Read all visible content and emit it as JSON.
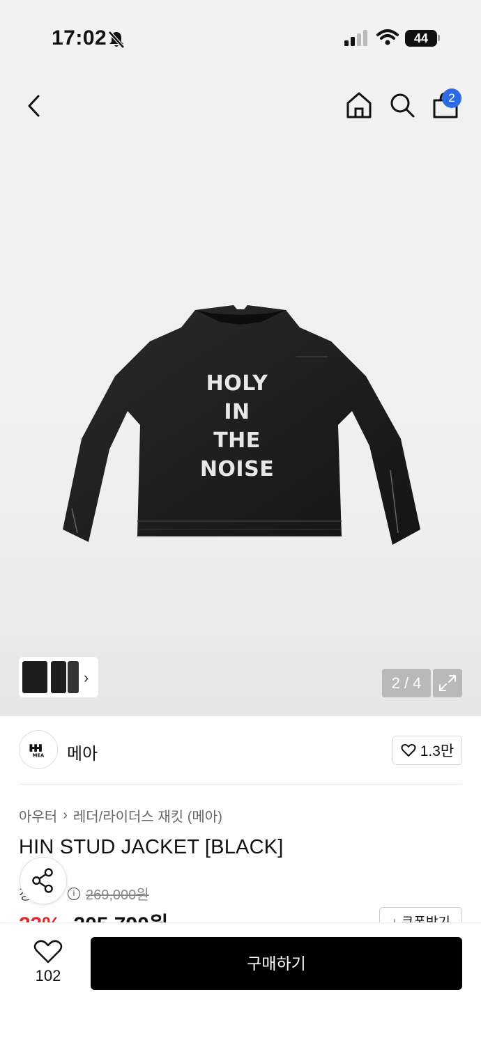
{
  "status_bar": {
    "time": "17:02",
    "battery": "44"
  },
  "header": {
    "cart_count": "2"
  },
  "hero": {
    "print_lines": [
      "HOLY",
      "IN",
      "THE",
      "NOISE"
    ],
    "counter": "2 / 4"
  },
  "brand": {
    "name": "메아",
    "likes": "1.3만",
    "logo_text": "MEA"
  },
  "breadcrumb": {
    "items": [
      "아우터",
      "레더/라이더스 재킷 (메아)"
    ]
  },
  "product": {
    "title": "HIN STUD JACKET [BLACK]",
    "price_label": "정상가",
    "original_price": "269,000원",
    "discount_rate": "23%",
    "sale_price": "205,790원",
    "coupon_label": "쿠폰받기"
  },
  "bottom_bar": {
    "wish_count": "102",
    "buy_label": "구매하기"
  },
  "colors": {
    "badge": "#2f6ae6",
    "discount": "#e0282a",
    "buy_button": "#000000"
  }
}
